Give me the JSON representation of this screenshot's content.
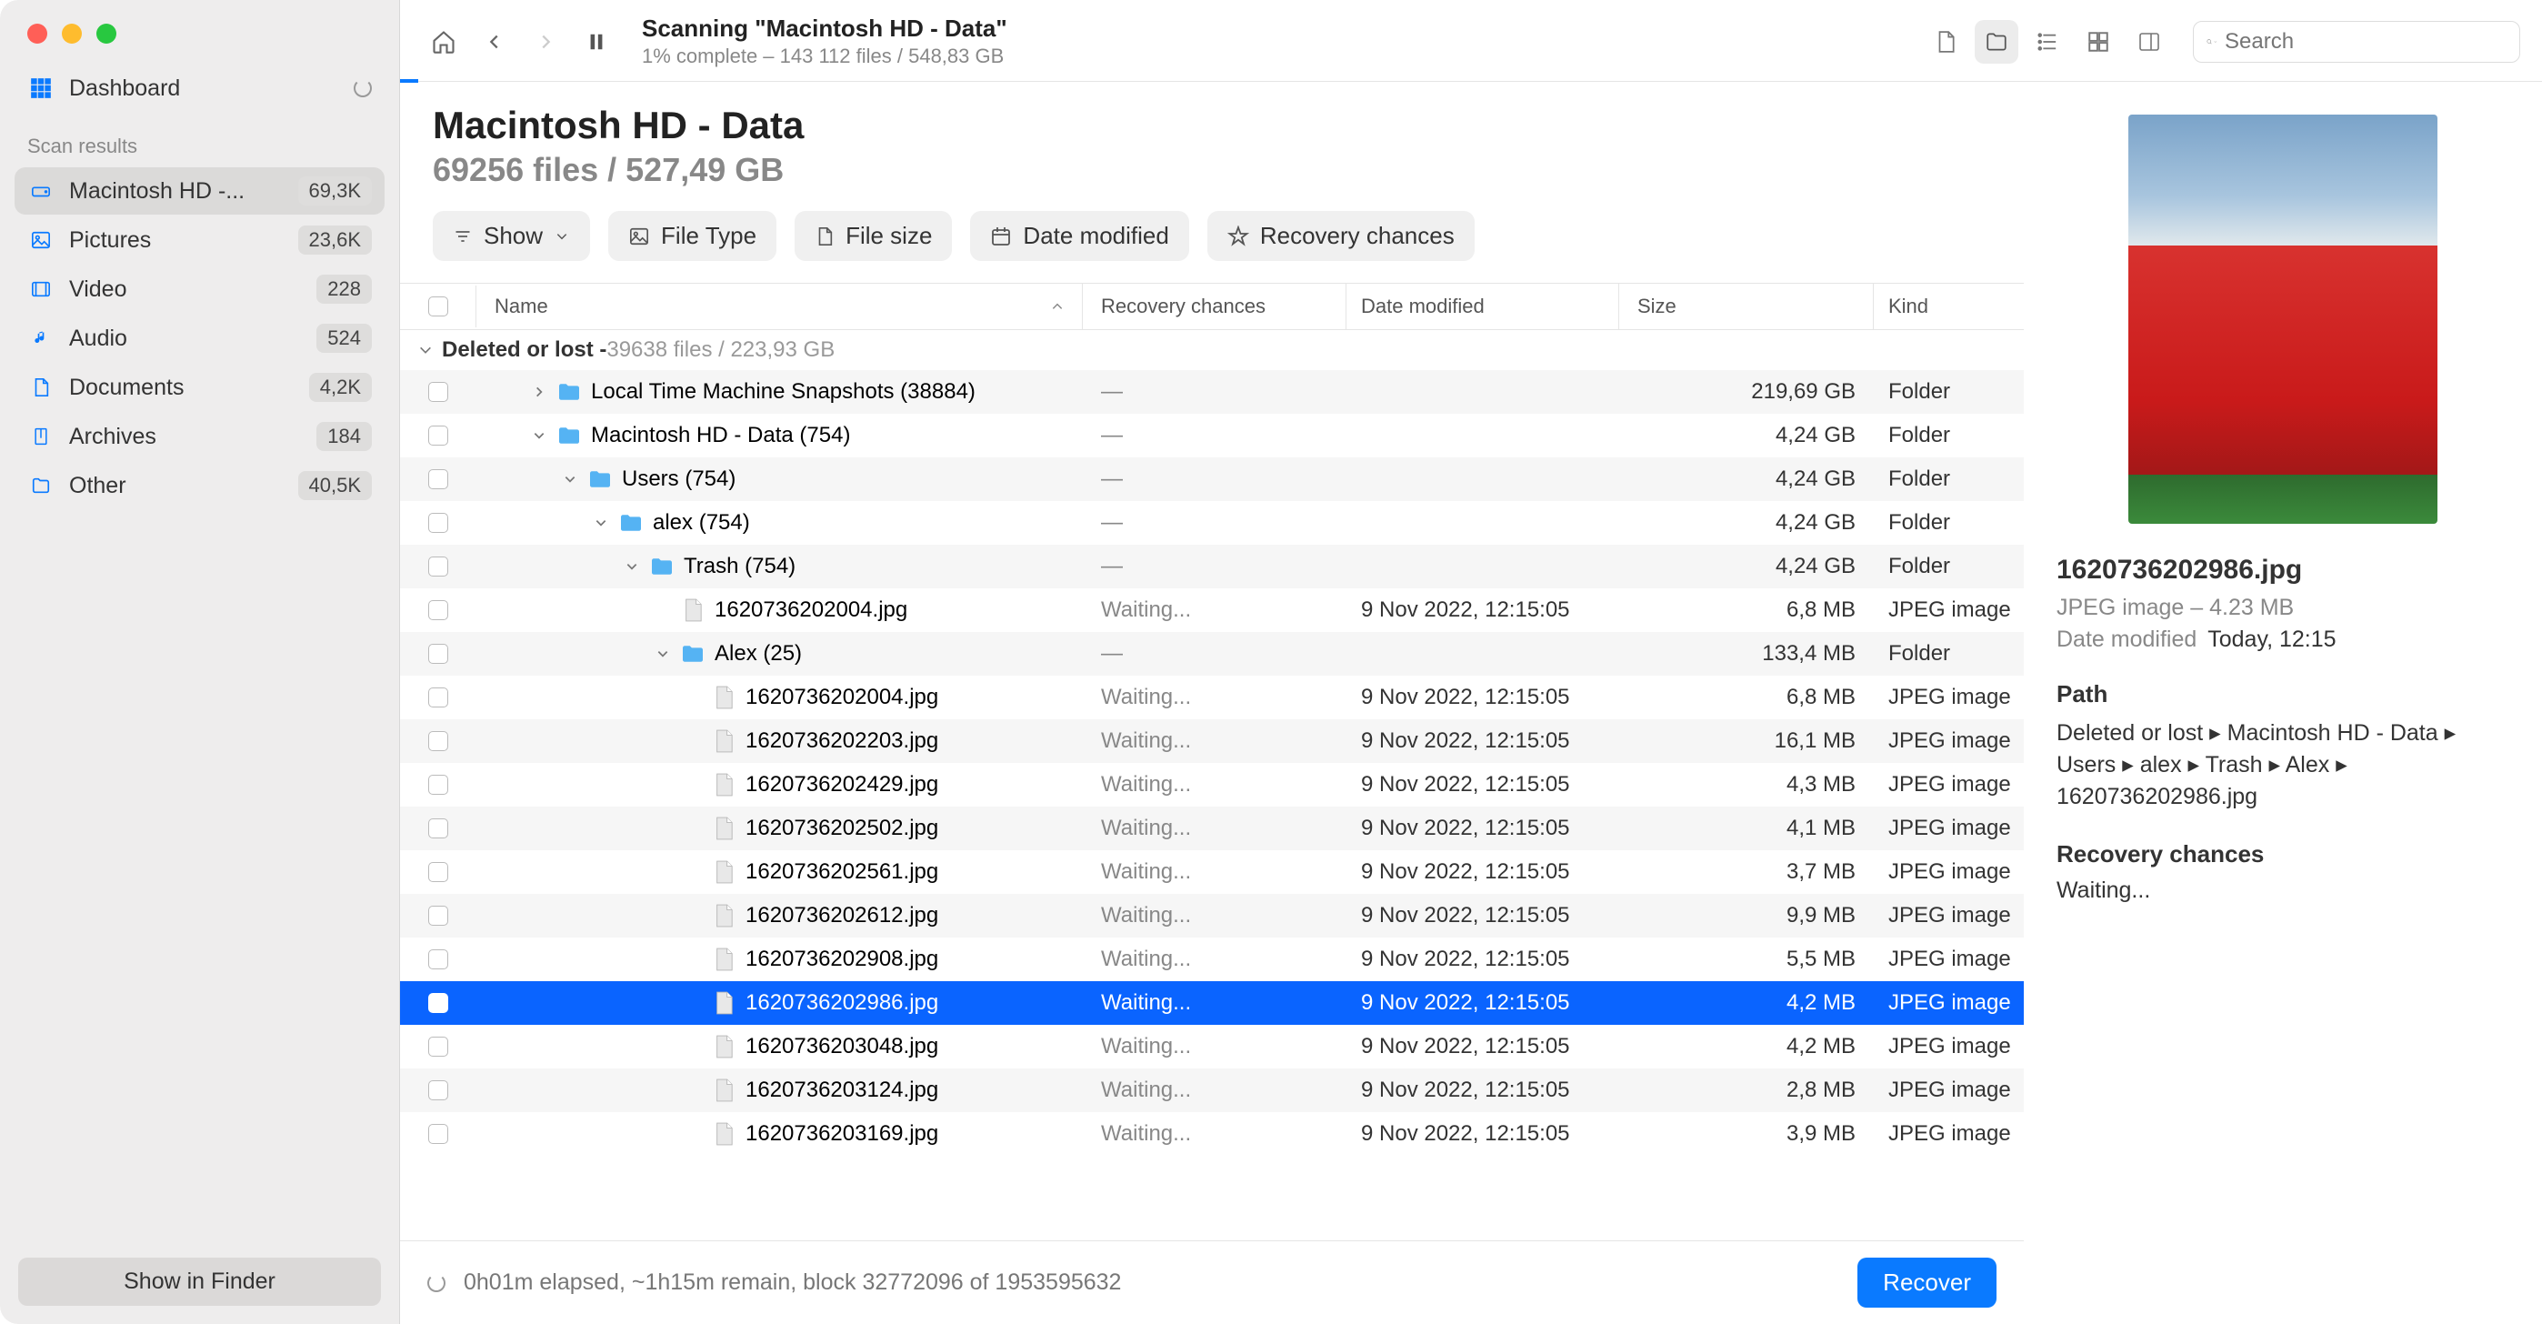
{
  "sidebar": {
    "dashboard": "Dashboard",
    "section": "Scan results",
    "items": [
      {
        "label": "Macintosh HD -...",
        "badge": "69,3K",
        "icon": "drive",
        "selected": true
      },
      {
        "label": "Pictures",
        "badge": "23,6K",
        "icon": "image"
      },
      {
        "label": "Video",
        "badge": "228",
        "icon": "video"
      },
      {
        "label": "Audio",
        "badge": "524",
        "icon": "music"
      },
      {
        "label": "Documents",
        "badge": "4,2K",
        "icon": "doc"
      },
      {
        "label": "Archives",
        "badge": "184",
        "icon": "archive"
      },
      {
        "label": "Other",
        "badge": "40,5K",
        "icon": "folder"
      }
    ],
    "showfinder": "Show in Finder"
  },
  "toolbar": {
    "title": "Scanning \"Macintosh HD - Data\"",
    "sub": "1% complete – 143 112 files / 548,83 GB",
    "search_placeholder": "Search"
  },
  "header": {
    "title": "Macintosh HD - Data",
    "sub": "69256 files / 527,49 GB"
  },
  "filters": {
    "show": "Show",
    "type": "File Type",
    "size": "File size",
    "date": "Date modified",
    "chances": "Recovery chances"
  },
  "columns": {
    "name": "Name",
    "rec": "Recovery chances",
    "date": "Date modified",
    "size": "Size",
    "kind": "Kind"
  },
  "group": {
    "title": "Deleted or lost - ",
    "meta": "39638 files / 223,93 GB"
  },
  "rows": [
    {
      "indent": 0,
      "disc": "right",
      "ftype": "folder",
      "name": "Local Time Machine Snapshots (38884)",
      "rec": "—",
      "date": "",
      "size": "219,69 GB",
      "kind": "Folder",
      "odd": true
    },
    {
      "indent": 0,
      "disc": "down",
      "ftype": "folder",
      "name": "Macintosh HD - Data (754)",
      "rec": "—",
      "date": "",
      "size": "4,24 GB",
      "kind": "Folder"
    },
    {
      "indent": 1,
      "disc": "down",
      "ftype": "folder",
      "name": "Users (754)",
      "rec": "—",
      "date": "",
      "size": "4,24 GB",
      "kind": "Folder",
      "odd": true
    },
    {
      "indent": 2,
      "disc": "down",
      "ftype": "folder",
      "name": "alex (754)",
      "rec": "—",
      "date": "",
      "size": "4,24 GB",
      "kind": "Folder"
    },
    {
      "indent": 3,
      "disc": "down",
      "ftype": "folder",
      "name": "Trash (754)",
      "rec": "—",
      "date": "",
      "size": "4,24 GB",
      "kind": "Folder",
      "odd": true
    },
    {
      "indent": 4,
      "disc": "",
      "ftype": "file",
      "name": "1620736202004.jpg",
      "rec": "Waiting...",
      "date": "9 Nov 2022, 12:15:05",
      "size": "6,8 MB",
      "kind": "JPEG image"
    },
    {
      "indent": 4,
      "disc": "down",
      "ftype": "folder",
      "name": "Alex (25)",
      "rec": "—",
      "date": "",
      "size": "133,4 MB",
      "kind": "Folder",
      "odd": true
    },
    {
      "indent": 5,
      "disc": "",
      "ftype": "file",
      "name": "1620736202004.jpg",
      "rec": "Waiting...",
      "date": "9 Nov 2022, 12:15:05",
      "size": "6,8 MB",
      "kind": "JPEG image"
    },
    {
      "indent": 5,
      "disc": "",
      "ftype": "file",
      "name": "1620736202203.jpg",
      "rec": "Waiting...",
      "date": "9 Nov 2022, 12:15:05",
      "size": "16,1 MB",
      "kind": "JPEG image",
      "odd": true
    },
    {
      "indent": 5,
      "disc": "",
      "ftype": "file",
      "name": "1620736202429.jpg",
      "rec": "Waiting...",
      "date": "9 Nov 2022, 12:15:05",
      "size": "4,3 MB",
      "kind": "JPEG image"
    },
    {
      "indent": 5,
      "disc": "",
      "ftype": "file",
      "name": "1620736202502.jpg",
      "rec": "Waiting...",
      "date": "9 Nov 2022, 12:15:05",
      "size": "4,1 MB",
      "kind": "JPEG image",
      "odd": true
    },
    {
      "indent": 5,
      "disc": "",
      "ftype": "file",
      "name": "1620736202561.jpg",
      "rec": "Waiting...",
      "date": "9 Nov 2022, 12:15:05",
      "size": "3,7 MB",
      "kind": "JPEG image"
    },
    {
      "indent": 5,
      "disc": "",
      "ftype": "file",
      "name": "1620736202612.jpg",
      "rec": "Waiting...",
      "date": "9 Nov 2022, 12:15:05",
      "size": "9,9 MB",
      "kind": "JPEG image",
      "odd": true
    },
    {
      "indent": 5,
      "disc": "",
      "ftype": "file",
      "name": "1620736202908.jpg",
      "rec": "Waiting...",
      "date": "9 Nov 2022, 12:15:05",
      "size": "5,5 MB",
      "kind": "JPEG image"
    },
    {
      "indent": 5,
      "disc": "",
      "ftype": "file",
      "name": "1620736202986.jpg",
      "rec": "Waiting...",
      "date": "9 Nov 2022, 12:15:05",
      "size": "4,2 MB",
      "kind": "JPEG image",
      "sel": true
    },
    {
      "indent": 5,
      "disc": "",
      "ftype": "file",
      "name": "1620736203048.jpg",
      "rec": "Waiting...",
      "date": "9 Nov 2022, 12:15:05",
      "size": "4,2 MB",
      "kind": "JPEG image"
    },
    {
      "indent": 5,
      "disc": "",
      "ftype": "file",
      "name": "1620736203124.jpg",
      "rec": "Waiting...",
      "date": "9 Nov 2022, 12:15:05",
      "size": "2,8 MB",
      "kind": "JPEG image",
      "odd": true
    },
    {
      "indent": 5,
      "disc": "",
      "ftype": "file",
      "name": "1620736203169.jpg",
      "rec": "Waiting...",
      "date": "9 Nov 2022, 12:15:05",
      "size": "3,9 MB",
      "kind": "JPEG image"
    }
  ],
  "preview": {
    "name": "1620736202986.jpg",
    "line1": "JPEG image – 4.23 MB",
    "date_label": "Date modified",
    "date_val": "Today, 12:15",
    "path_label": "Path",
    "path": "Deleted or lost ▸ Macintosh HD - Data ▸ Users ▸ alex ▸ Trash ▸ Alex ▸ 1620736202986.jpg",
    "chances_label": "Recovery chances",
    "chances_val": "Waiting..."
  },
  "bottom": {
    "status": "0h01m elapsed, ~1h15m remain, block 32772096 of 1953595632",
    "recover": "Recover"
  }
}
